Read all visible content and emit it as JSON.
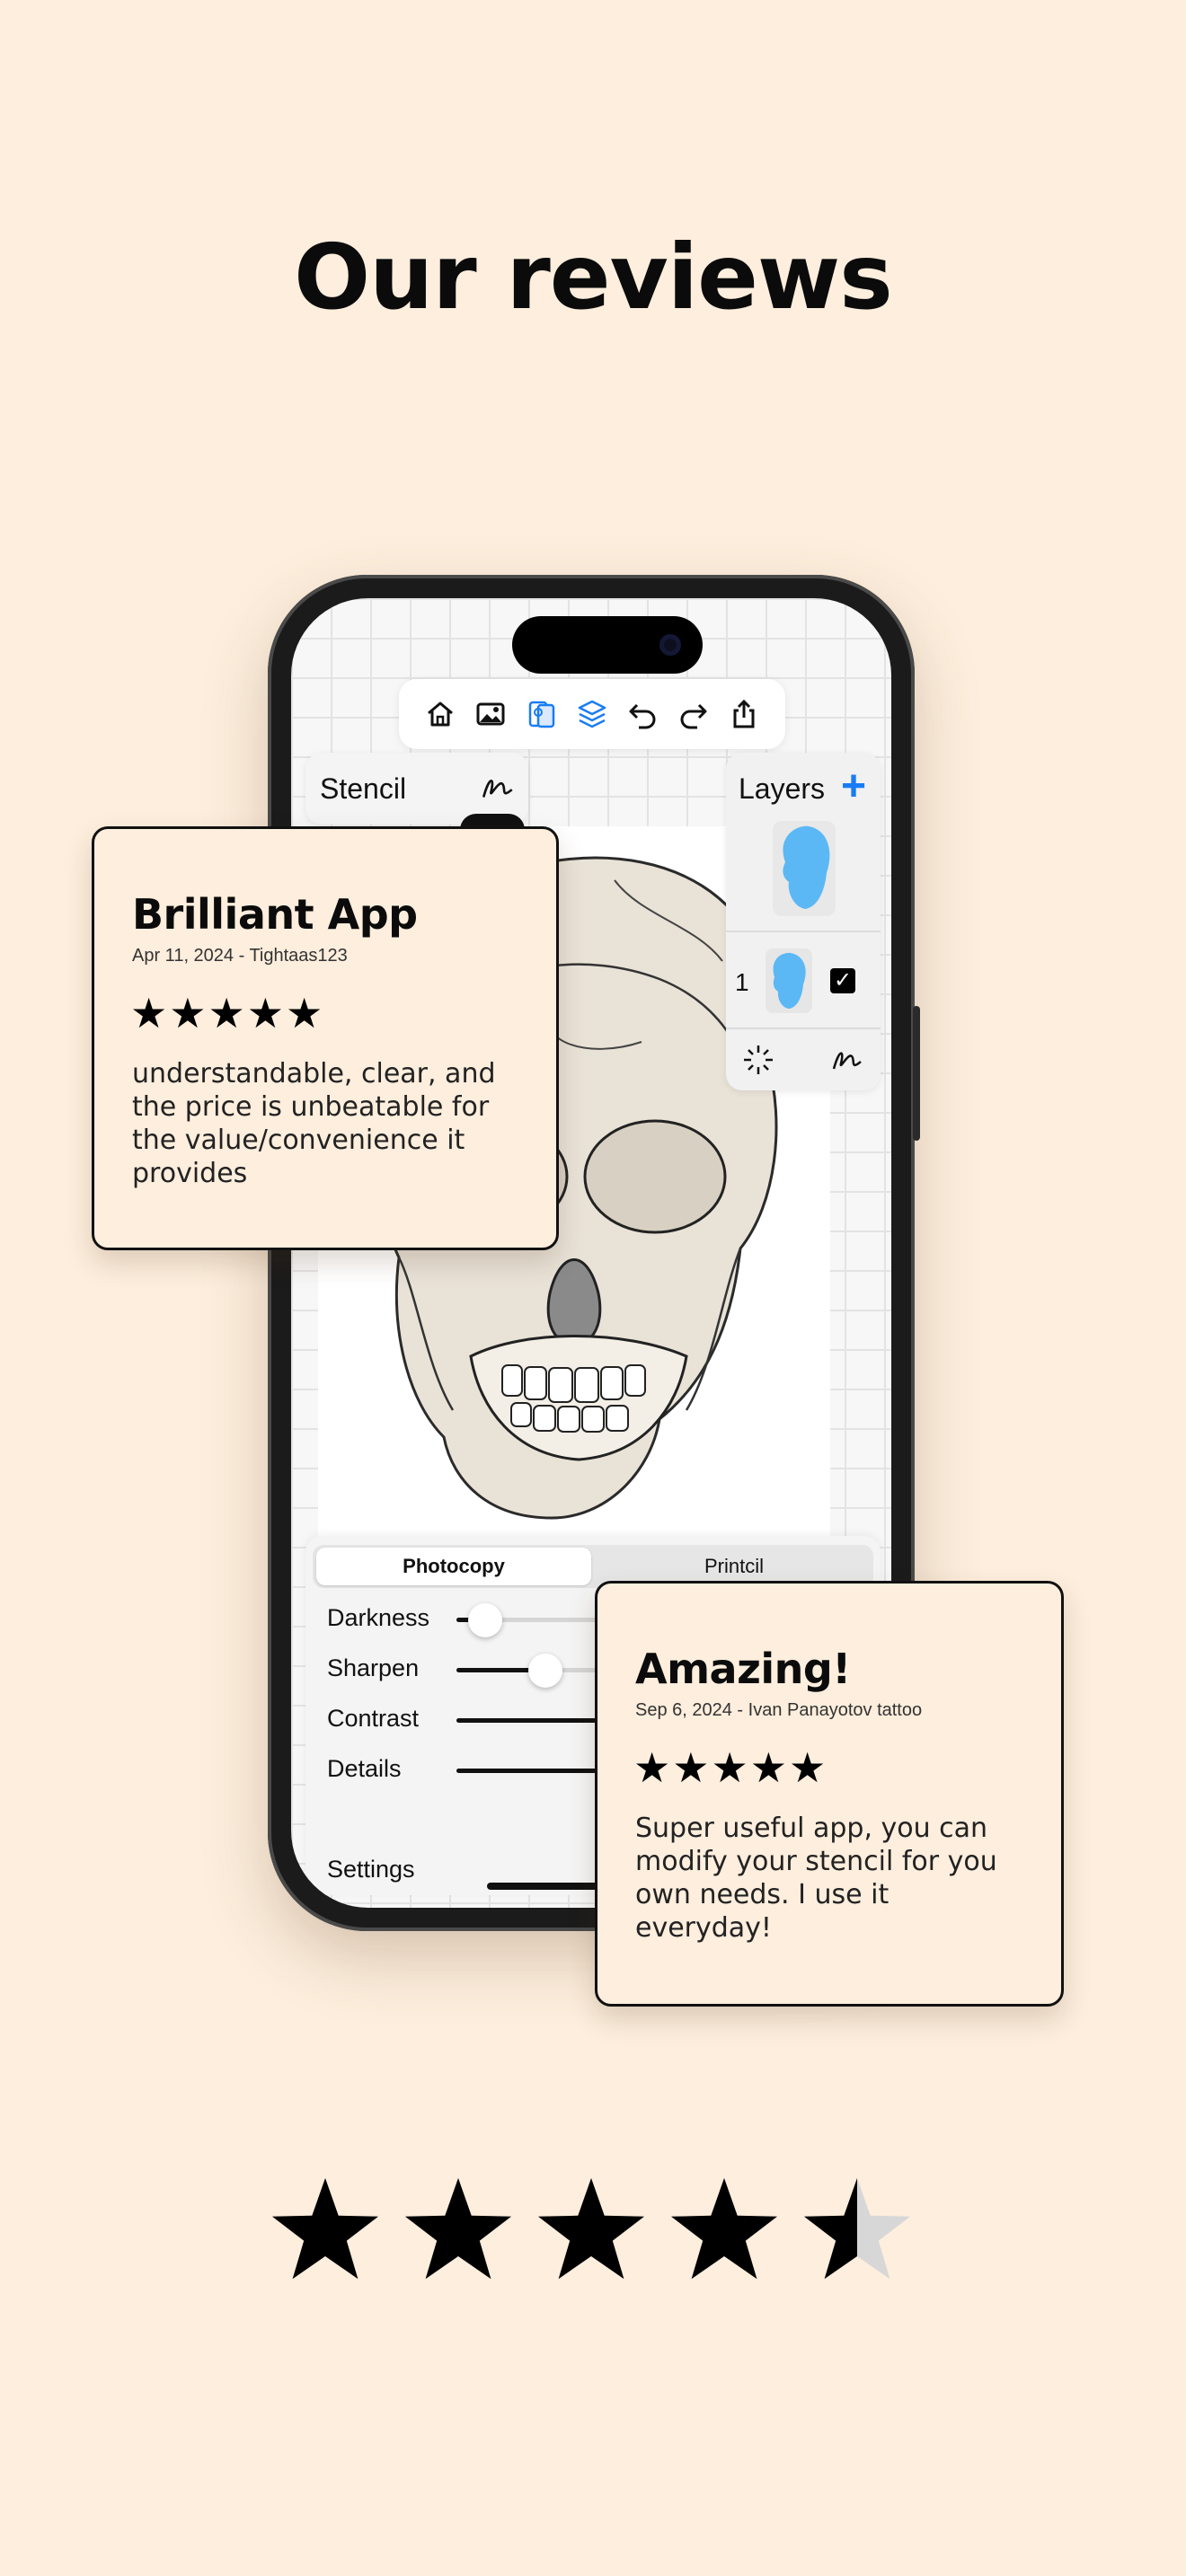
{
  "page": {
    "headline": "Our reviews",
    "background": "#fdeedd"
  },
  "app": {
    "toolbar": {
      "icons": [
        "home-icon",
        "image-icon",
        "stencil-cards-icon",
        "layers-stack-icon",
        "undo-icon",
        "redo-icon",
        "share-icon"
      ],
      "active_color": "#1a7cf5"
    },
    "stencil_panel": {
      "title": "Stencil",
      "toggle_on": true
    },
    "layers_panel": {
      "title": "Layers",
      "add_label": "+",
      "layer_number": "1",
      "checkbox": "✓"
    },
    "modes": {
      "active": "Photocopy",
      "inactive": "Printcil"
    },
    "sliders": [
      {
        "label": "Darkness",
        "value": 0.05
      },
      {
        "label": "Sharpen",
        "value": 0.2
      },
      {
        "label": "Contrast",
        "value": 0.55
      },
      {
        "label": "Details",
        "value": 0.45
      }
    ],
    "settings_label": "Settings",
    "accent_color": "#1a7cf5",
    "layer_thumb_color": "#5bb8f5"
  },
  "reviews": [
    {
      "title": "Brilliant App",
      "meta": "Apr 11, 2024 - Tightaas123",
      "stars": "★★★★★",
      "body": "understandable, clear, and the price is unbeatable for the value/convenience it provides"
    },
    {
      "title": "Amazing!",
      "meta": "Sep 6, 2024 - Ivan Panayotov tattoo",
      "stars": "★★★★★",
      "body": "Super useful app, you can modify your stencil for you own needs. I use it everyday!"
    }
  ],
  "overall_rating": {
    "value": 4.5,
    "max": 5
  }
}
